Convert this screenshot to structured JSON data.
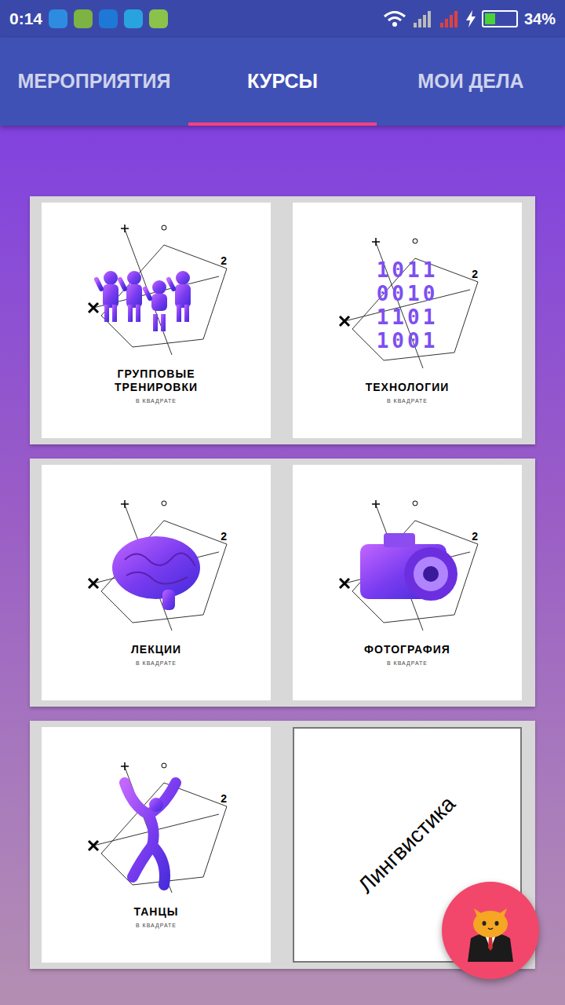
{
  "status_bar": {
    "time": "0:14",
    "battery": "34%",
    "battery_level": 0.34,
    "charging": true
  },
  "tabs": [
    {
      "label": "МЕРОПРИЯТИЯ",
      "selected": false
    },
    {
      "label": "КУРСЫ",
      "selected": true
    },
    {
      "label": "МОИ ДЕЛА",
      "selected": false
    }
  ],
  "courses": [
    {
      "kind": "people",
      "title_lines": [
        "ГРУППОВЫЕ",
        "ТРЕНИРОВКИ"
      ],
      "subtitle": "В КВАДРАТЕ",
      "mark": "2"
    },
    {
      "kind": "binary",
      "title_lines": [
        "ТЕХНОЛОГИИ"
      ],
      "subtitle": "В КВАДРАТЕ",
      "mark": "2",
      "digits": [
        "1011",
        "0010",
        "1101",
        "1001"
      ]
    },
    {
      "kind": "brain",
      "title_lines": [
        "ЛЕКЦИИ"
      ],
      "subtitle": "В КВАДРАТЕ",
      "mark": "2"
    },
    {
      "kind": "camera",
      "title_lines": [
        "ФОТОГРАФИЯ"
      ],
      "subtitle": "В КВАДРАТЕ",
      "mark": "2"
    },
    {
      "kind": "dancer",
      "title_lines": [
        "ТАНЦЫ"
      ],
      "subtitle": "В КВАДРАТЕ",
      "mark": "2"
    },
    {
      "kind": "text",
      "title_lines": [
        "Лингвистика"
      ]
    }
  ]
}
